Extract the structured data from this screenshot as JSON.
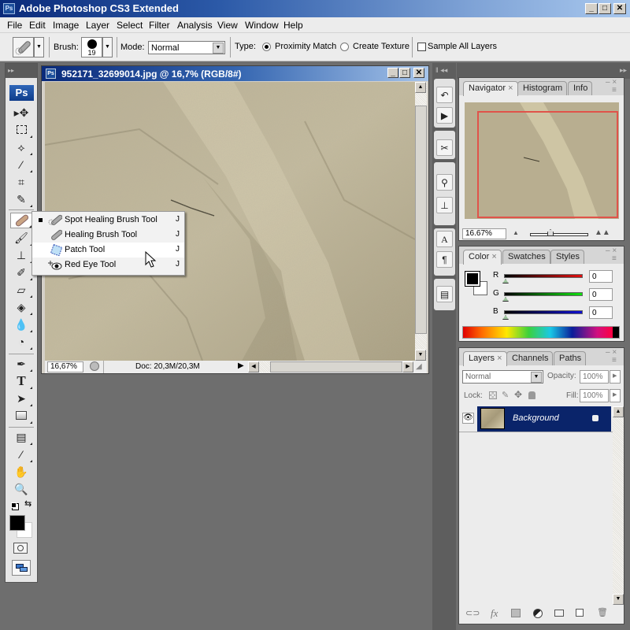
{
  "app": {
    "title": "Adobe Photoshop CS3 Extended",
    "icon": "ps-icon"
  },
  "window_controls": {
    "minimize": "_",
    "maximize": "□",
    "close": "✕"
  },
  "menu": [
    "File",
    "Edit",
    "Image",
    "Layer",
    "Select",
    "Filter",
    "Analysis",
    "View",
    "Window",
    "Help"
  ],
  "options": {
    "brush_label": "Brush:",
    "brush_size": "19",
    "mode_label": "Mode:",
    "mode_value": "Normal",
    "type_label": "Type:",
    "type_options": [
      {
        "label": "Proximity Match",
        "selected": true
      },
      {
        "label": "Create Texture",
        "selected": false
      }
    ],
    "sample_all_layers": {
      "label": "Sample All Layers",
      "checked": false
    }
  },
  "toolbox": {
    "logo": "Ps",
    "tools": [
      "move-tool",
      "marquee-tool",
      "lasso-tool",
      "magic-wand-tool",
      "crop-tool",
      "slice-tool",
      "healing-tool",
      "brush-tool",
      "clone-stamp-tool",
      "history-brush-tool",
      "eraser-tool",
      "paint-bucket-tool",
      "blur-tool",
      "dodge-tool",
      "pen-tool",
      "type-tool",
      "path-selection-tool",
      "shape-tool",
      "notes-tool",
      "eyedropper-tool",
      "hand-tool",
      "zoom-tool"
    ]
  },
  "flyout": {
    "items": [
      {
        "label": "Spot Healing Brush Tool",
        "shortcut": "J",
        "active": true
      },
      {
        "label": "Healing Brush Tool",
        "shortcut": "J",
        "active": false
      },
      {
        "label": "Patch Tool",
        "shortcut": "J",
        "active": false,
        "hovered": true
      },
      {
        "label": "Red Eye Tool",
        "shortcut": "J",
        "active": false
      }
    ]
  },
  "document": {
    "title": "952171_32699014.jpg @ 16,7% (RGB/8#)",
    "zoom": "16,67%",
    "doc_size": "Doc: 20,3M/20,3M"
  },
  "navigator": {
    "tabs": [
      "Navigator",
      "Histogram",
      "Info"
    ],
    "active_tab": "Navigator",
    "zoom": "16.67%",
    "view_box_color": "#e0534a"
  },
  "color": {
    "tabs": [
      "Color",
      "Swatches",
      "Styles"
    ],
    "active_tab": "Color",
    "channels": [
      {
        "label": "R",
        "value": "0",
        "color": "#e01010"
      },
      {
        "label": "G",
        "value": "0",
        "color": "#10e010"
      },
      {
        "label": "B",
        "value": "0",
        "color": "#1010d0"
      }
    ],
    "foreground": "#000000",
    "background": "#ffffff"
  },
  "layers": {
    "tabs": [
      "Layers",
      "Channels",
      "Paths"
    ],
    "active_tab": "Layers",
    "blend_mode": "Normal",
    "opacity_label": "Opacity:",
    "opacity": "100%",
    "lock_label": "Lock:",
    "fill_label": "Fill:",
    "fill": "100%",
    "items": [
      {
        "name": "Background",
        "visible": true,
        "locked": true,
        "selected": true
      }
    ],
    "selected_color": "#0a246a",
    "footer_icons": [
      "link-layers-icon",
      "fx-icon",
      "layer-mask-icon",
      "adjustment-layer-icon",
      "new-group-icon",
      "new-layer-icon",
      "delete-layer-icon"
    ]
  }
}
